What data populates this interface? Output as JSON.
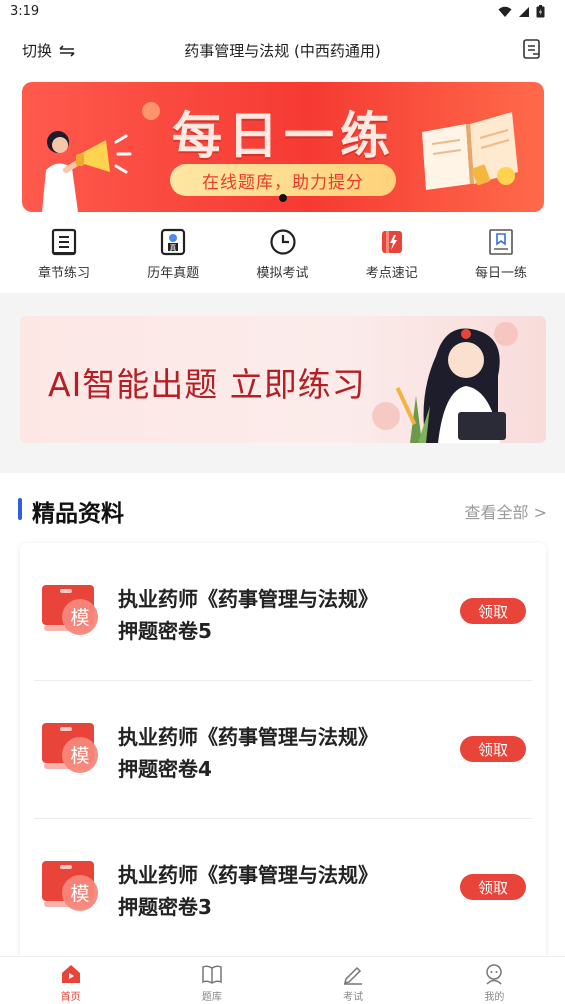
{
  "status_bar": {
    "time": "3:19"
  },
  "header": {
    "switch_label": "切换",
    "title": "药事管理与法规 (中西药通用)"
  },
  "banner": {
    "title": "每日一练",
    "subtitle": "在线题库，助力提分"
  },
  "quick_nav": [
    {
      "label": "章节练习",
      "icon": "chapter-icon"
    },
    {
      "label": "历年真题",
      "icon": "past-exam-icon"
    },
    {
      "label": "模拟考试",
      "icon": "clock-icon"
    },
    {
      "label": "考点速记",
      "icon": "notes-icon"
    },
    {
      "label": "每日一练",
      "icon": "bookmark-icon"
    }
  ],
  "ai_banner": {
    "text": "AI智能出题  立即练习"
  },
  "section": {
    "title": "精品资料",
    "more_label": "查看全部 >"
  },
  "resources": [
    {
      "line1": "执业药师《药事管理与法规》",
      "line2": "押题密卷5",
      "badge": "模",
      "action": "领取"
    },
    {
      "line1": "执业药师《药事管理与法规》",
      "line2": "押题密卷4",
      "badge": "模",
      "action": "领取"
    },
    {
      "line1": "执业药师《药事管理与法规》",
      "line2": "押题密卷3",
      "badge": "模",
      "action": "领取"
    }
  ],
  "tabbar": [
    {
      "label": "首页",
      "icon": "home-icon",
      "active": true
    },
    {
      "label": "题库",
      "icon": "book-icon",
      "active": false
    },
    {
      "label": "考试",
      "icon": "pen-icon",
      "active": false
    },
    {
      "label": "我的",
      "icon": "user-icon",
      "active": false
    }
  ],
  "colors": {
    "accent": "#e8443a",
    "section_bar": "#2f5fe0",
    "banner_red": "#f53a33"
  }
}
